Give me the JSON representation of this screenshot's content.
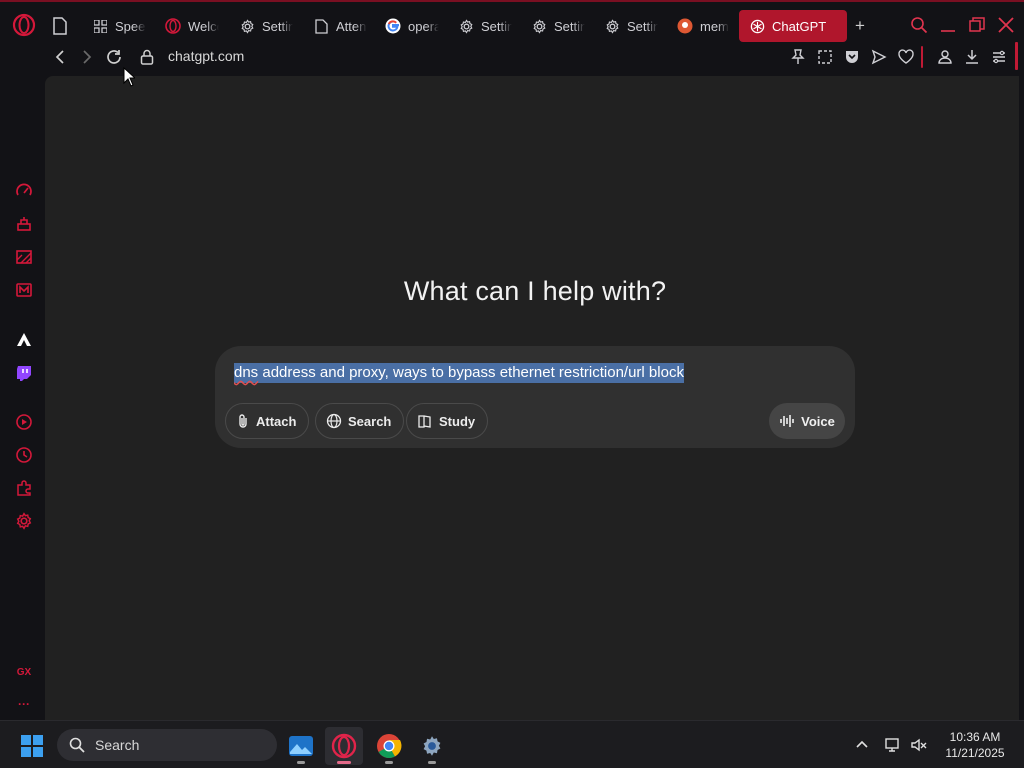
{
  "browser": {
    "tabs": [
      {
        "label": "Speed Dial",
        "icon": "speed-dial-icon"
      },
      {
        "label": "Welcome",
        "icon": "opera-icon"
      },
      {
        "label": "Settings",
        "icon": "gear-icon"
      },
      {
        "label": "Attention",
        "icon": "document-icon"
      },
      {
        "label": "opera",
        "icon": "google-icon"
      },
      {
        "label": "Settings",
        "icon": "gear-icon"
      },
      {
        "label": "Settings",
        "icon": "gear-icon"
      },
      {
        "label": "Settings",
        "icon": "gear-icon"
      },
      {
        "label": "mem",
        "icon": "duckduckgo-icon"
      },
      {
        "label": "ChatGPT",
        "icon": "chatgpt-icon",
        "active": true
      }
    ],
    "address": "chatgpt.com"
  },
  "page": {
    "headline": "What can I help with?",
    "prompt_text": "dns address and proxy, ways to bypass ethernet restriction/url block",
    "prompt_first_word": "dns",
    "prompt_rest": " address and proxy, ways to bypass ethernet restriction/url block",
    "buttons": {
      "attach": "Attach",
      "search": "Search",
      "study": "Study",
      "voice": "Voice"
    }
  },
  "sidebar": {
    "items": [
      "speedometer-icon",
      "aria-icon",
      "wallpaper-icon",
      "gmail-icon",
      "aria-ai-icon",
      "twitch-icon",
      "player-icon",
      "history-icon",
      "extensions-icon",
      "settings-icon"
    ],
    "gx_label": "GX",
    "more_label": "···"
  },
  "taskbar": {
    "search_label": "Search",
    "time": "10:36 AM",
    "date": "11/21/2025"
  },
  "colors": {
    "accent": "#b0162c",
    "content_bg": "#212121",
    "composer_bg": "#303030",
    "selection": "#4a6fa5"
  }
}
